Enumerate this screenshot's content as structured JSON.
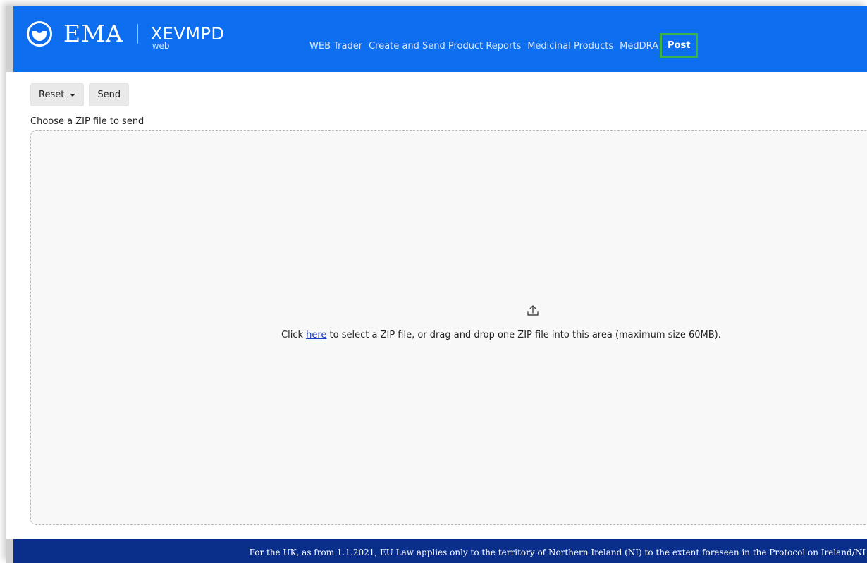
{
  "header": {
    "logo_text": "EMA",
    "product_name": "XEVMPD",
    "product_sub": "web",
    "nav": [
      {
        "label": "WEB Trader",
        "active": false
      },
      {
        "label": "Create and Send Product Reports",
        "active": false
      },
      {
        "label": "Medicinal Products",
        "active": false
      },
      {
        "label": "MedDRA",
        "active": false
      },
      {
        "label": "Post",
        "active": true
      }
    ]
  },
  "toolbar": {
    "reset_label": "Reset",
    "send_label": "Send"
  },
  "form": {
    "choose_label": "Choose a ZIP file to send"
  },
  "dropzone": {
    "icon": "upload-icon",
    "text_before": "Click ",
    "link_text": "here",
    "text_after": " to select a ZIP file, or drag and drop one ZIP file into this area (maximum size 60MB)."
  },
  "footer": {
    "text": "For the UK, as from 1.1.2021, EU Law applies only to the territory of Northern Ireland (NI) to the extent foreseen in the Protocol on Ireland/NI"
  },
  "colors": {
    "header_bg": "#0e6ef0",
    "footer_bg": "#0a2f8a",
    "active_outline": "#3bb24a",
    "link": "#1a3ec9"
  }
}
